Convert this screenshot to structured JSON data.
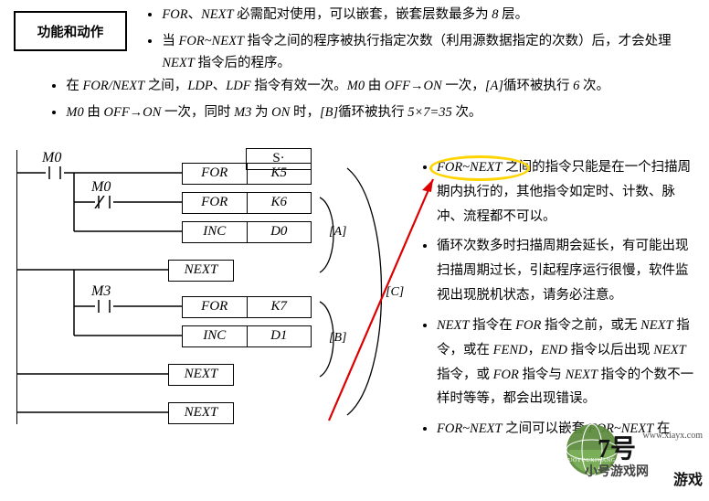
{
  "title_box": "功能和动作",
  "top_b1": "<i>FOR</i>、<i>NEXT</i> 必需配对使用，可以嵌套，嵌套层数最多为 <i>8</i> 层。",
  "top_b2": "当 <i>FOR~NEXT</i> 指令之间的程序被执行指定次数（利用源数据指定的次数）后，才会处理 <i>NEXT</i> 指令后的程序。",
  "mid_b1": "在 <i>FOR/NEXT</i> 之间，<i>LDP</i>、<i>LDF</i> 指令有效一次。<i>M0</i> 由 <i>OFF</i>→<i>ON</i> 一次，<i>[A]</i>循环被执行 <i>6</i> 次。",
  "mid_b2": "<i>M0</i> 由 <i>OFF</i>→<i>ON</i> 一次，同时 <i>M3</i> 为 <i>ON</i> 时，<i>[B]</i>循环被执行 <i>5×7=35</i> 次。",
  "ladder": {
    "s_hdr": "S·",
    "m0": "M0",
    "m0b": "M0",
    "m3": "M3",
    "r1a": "FOR",
    "r1b": "K5",
    "r2a": "FOR",
    "r2b": "K6",
    "r3a": "INC",
    "r3b": "D0",
    "r4": "NEXT",
    "r5a": "FOR",
    "r5b": "K7",
    "r6a": "INC",
    "r6b": "D1",
    "r7": "NEXT",
    "r8": "NEXT",
    "annA": "[A]",
    "annB": "[B]",
    "annC": "[C]"
  },
  "right": {
    "b1": "<i>FOR~NEXT</i> 之间的指令只能是在一个扫描周期内执行的，其他指令如定时、计数、脉冲、流程都不可以。",
    "b2": "循环次数多时扫描周期会延长，有可能出现扫描周期过长，引起程序运行很慢，软件监视出现脱机状态，请务必注意。",
    "b3": "<i>NEXT</i> 指令在 <i>FOR</i> 指令之前，或无 <i>NEXT</i> 指令，或在 <i>FEND</i>，<i>END</i> 指令以后出现 <i>NEXT</i> 指令，或 <i>FOR</i> 指令与 <i>NEXT</i> 指令的个数不一样时等等，都会出现错误。",
    "b4": "<i>FOR~NEXT</i> 之间可以嵌套 <i>FOR~NEXT</i> 在"
  },
  "wm": {
    "a": "7号",
    "b": "小号游戏网",
    "c": "www.xiayx.com",
    "d": "ZHUOYOUXIWANG",
    "e": "游戏"
  }
}
